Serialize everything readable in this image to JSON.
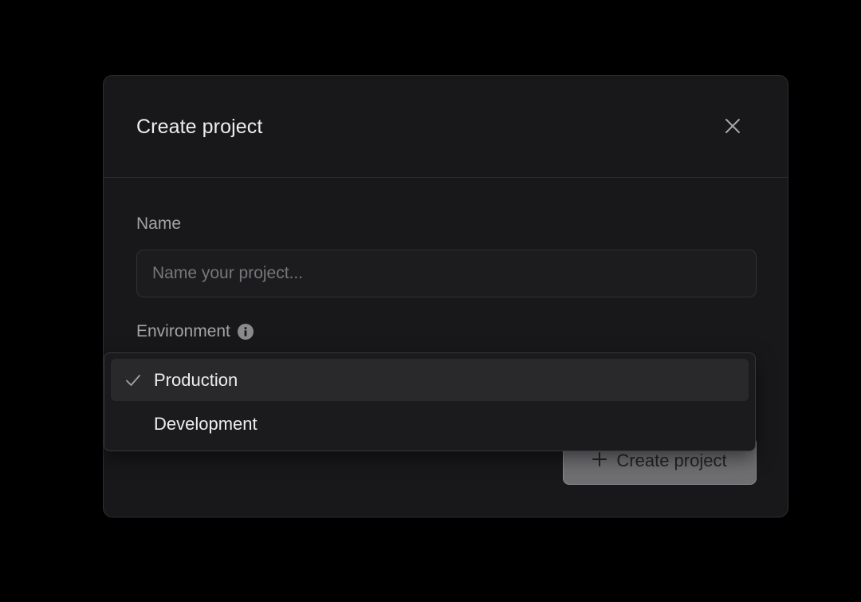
{
  "dialog": {
    "title": "Create project",
    "close_icon": "close-icon"
  },
  "name_field": {
    "label": "Name",
    "value": "",
    "placeholder": "Name your project..."
  },
  "environment_field": {
    "label": "Environment",
    "info_icon": "info-icon",
    "options": [
      {
        "label": "Production",
        "selected": true
      },
      {
        "label": "Development",
        "selected": false
      }
    ]
  },
  "submit": {
    "label": "Create project",
    "icon": "plus-icon"
  },
  "colors": {
    "background": "#000000",
    "modal": "#18181a",
    "text": "#ededed",
    "muted_text": "#a3a3a6",
    "button_bg": "#6f6f72"
  }
}
